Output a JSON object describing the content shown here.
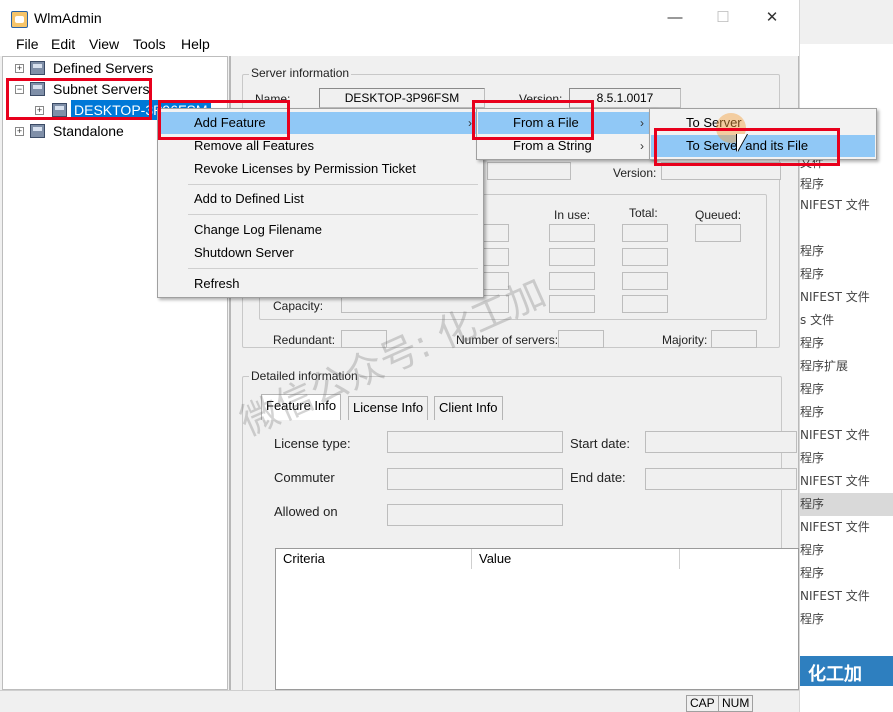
{
  "window": {
    "title": "WlmAdmin",
    "controls": {
      "minimize": "—",
      "maximize": "☐",
      "close": "✕"
    }
  },
  "menubar": [
    "File",
    "Edit",
    "View",
    "Tools",
    "Help"
  ],
  "tree": {
    "defined_servers": "Defined Servers",
    "subnet_servers": "Subnet Servers",
    "selected_server": "DESKTOP-3P96FSM",
    "standalone": "Standalone"
  },
  "server_info": {
    "group_label": "Server information",
    "name_label": "Name:",
    "name_value": "DESKTOP-3P96FSM",
    "version_label": "Version:",
    "version_value": "8.5.1.0017",
    "version2_label": "Version:",
    "in_use_label": "In use:",
    "total_label": "Total:",
    "queued_label": "Queued:",
    "capacity_label": "Capacity:",
    "redundant_label": "Redundant:",
    "num_servers_label": "Number of servers:",
    "majority_label": "Majority:"
  },
  "detailed": {
    "group_label": "Detailed information",
    "tabs": [
      "Feature Info",
      "License Info",
      "Client Info"
    ],
    "license_type_label": "License type:",
    "start_date_label": "Start date:",
    "commuter_label": "Commuter",
    "end_date_label": "End date:",
    "allowed_on_label": "Allowed on",
    "columns": [
      "Criteria",
      "Value"
    ]
  },
  "context_menu": {
    "items": [
      "Add Feature",
      "Remove all Features",
      "Revoke Licenses by Permission Ticket",
      "Add to Defined List",
      "Change Log Filename",
      "Shutdown Server",
      "Refresh"
    ]
  },
  "submenu1": {
    "items": [
      "From a File",
      "From a String"
    ]
  },
  "submenu2": {
    "items": [
      "To Server",
      "To Server and its File"
    ]
  },
  "status": {
    "cap": "CAP",
    "num": "NUM"
  },
  "background_window": {
    "rows": [
      "文件",
      "程序",
      "NIFEST 文件",
      "程序",
      "程序",
      "NIFEST 文件",
      "s 文件",
      "程序",
      "程序扩展",
      "程序",
      "程序",
      "NIFEST 文件",
      "程序",
      "NIFEST 文件",
      "程序",
      "NIFEST 文件",
      "程序",
      "程序",
      "NIFEST 文件",
      "程序"
    ],
    "footer_text": "化工加",
    "footer_badge": "⊘"
  },
  "watermark": "微信公众号: 化工加",
  "colors": {
    "highlight": "#90c8f6",
    "selection": "#0078d7",
    "annotation_red": "#e8001c"
  }
}
